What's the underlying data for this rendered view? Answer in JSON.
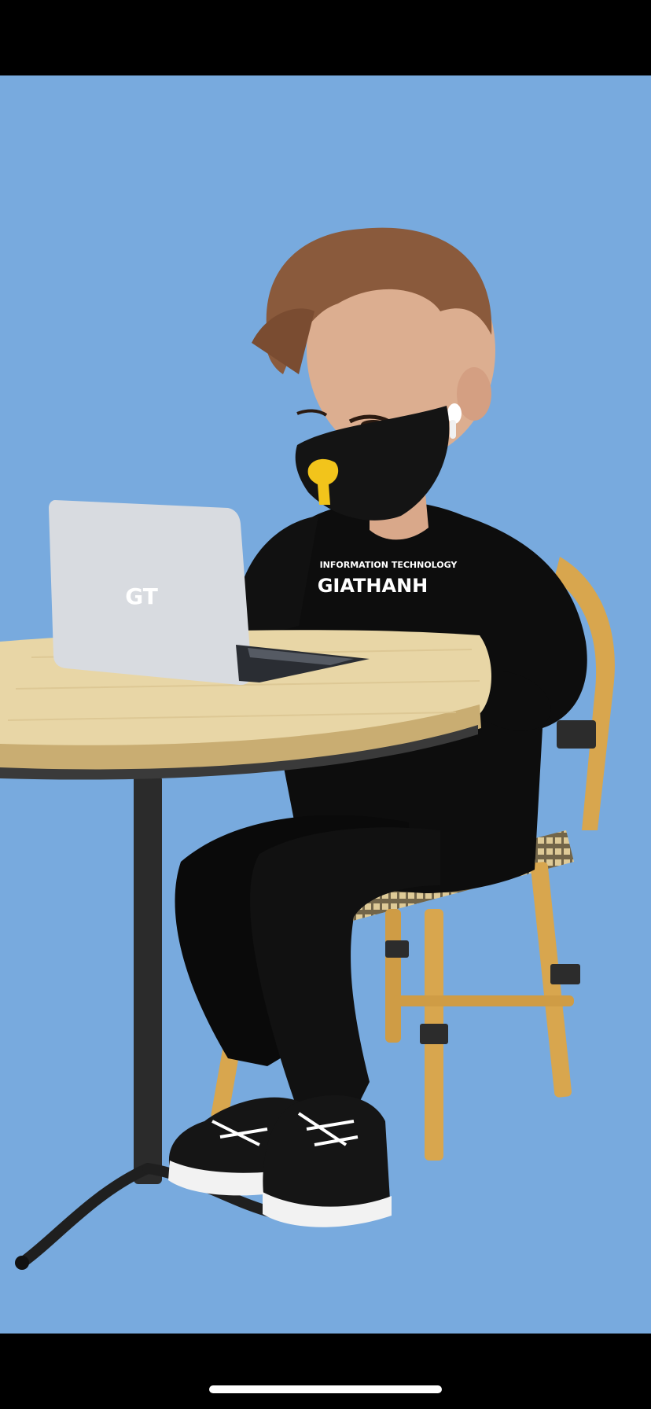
{
  "scene": {
    "background_color": "#78aade",
    "laptop_lid_text": "GT",
    "shirt_small_text": "INFORMATION TECHNOLOGY",
    "shirt_large_text": "GIATHANH"
  },
  "colors": {
    "bar": "#000000",
    "hair": "#8a5a3c",
    "skin": "#d9a88a",
    "mask": "#141414",
    "mask_logo": "#f2c41b",
    "shirt": "#0d0d0d",
    "pants": "#0a0a0a",
    "table_top": "#e8d6a6",
    "table_leg": "#2b2b2b",
    "laptop": "#d8dbe0",
    "chair": "#d8a64e"
  }
}
